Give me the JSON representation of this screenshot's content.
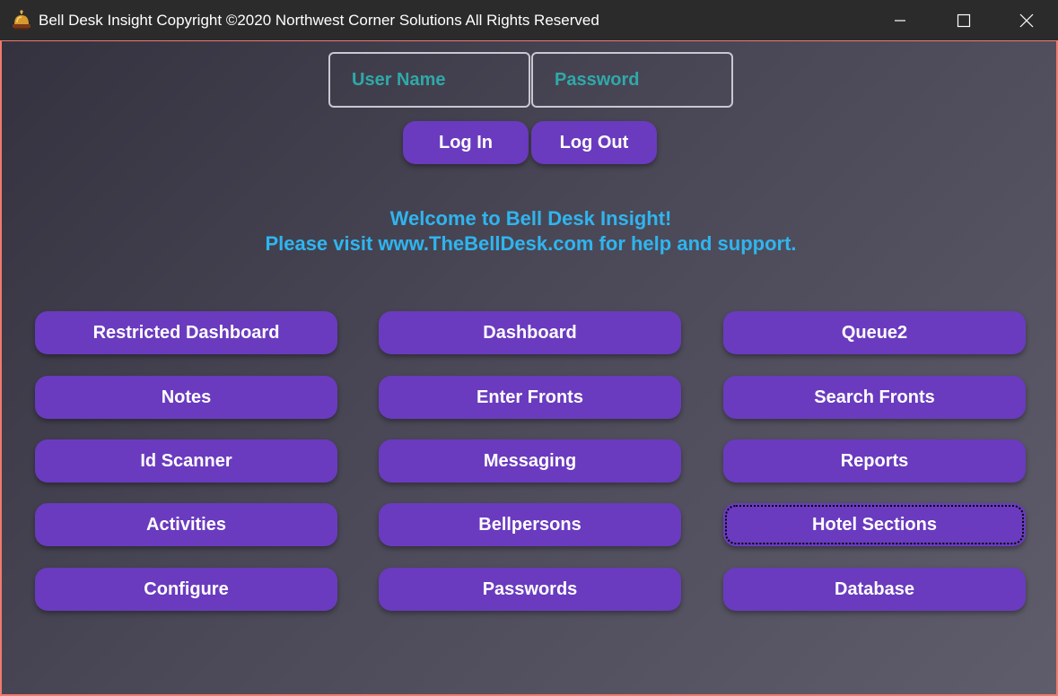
{
  "window": {
    "title": "Bell Desk Insight Copyright ©2020 Northwest Corner Solutions All Rights Reserved",
    "app_icon": "bell-icon",
    "controls": [
      "minimize-icon",
      "maximize-icon",
      "close-icon"
    ]
  },
  "login": {
    "username_placeholder": "User Name",
    "password_placeholder": "Password",
    "login_label": "Log In",
    "logout_label": "Log Out"
  },
  "welcome": {
    "line1": "Welcome to Bell Desk Insight!",
    "line2": "Please visit www.TheBellDesk.com for help and support."
  },
  "menu": {
    "restricted_dashboard": "Restricted Dashboard",
    "dashboard": "Dashboard",
    "queue2": "Queue2",
    "notes": "Notes",
    "enter_fronts": "Enter Fronts",
    "search_fronts": "Search Fronts",
    "id_scanner": "Id Scanner",
    "messaging": "Messaging",
    "reports": "Reports",
    "activities": "Activities",
    "bellpersons": "Bellpersons",
    "hotel_sections": "Hotel Sections",
    "configure": "Configure",
    "passwords": "Passwords",
    "database": "Database"
  },
  "colors": {
    "accent_button": "#6a3bbf",
    "welcome_text": "#2fb5f0",
    "input_text": "#3cb6b6",
    "window_border": "#f07a6e",
    "titlebar": "#2b2b2b"
  }
}
